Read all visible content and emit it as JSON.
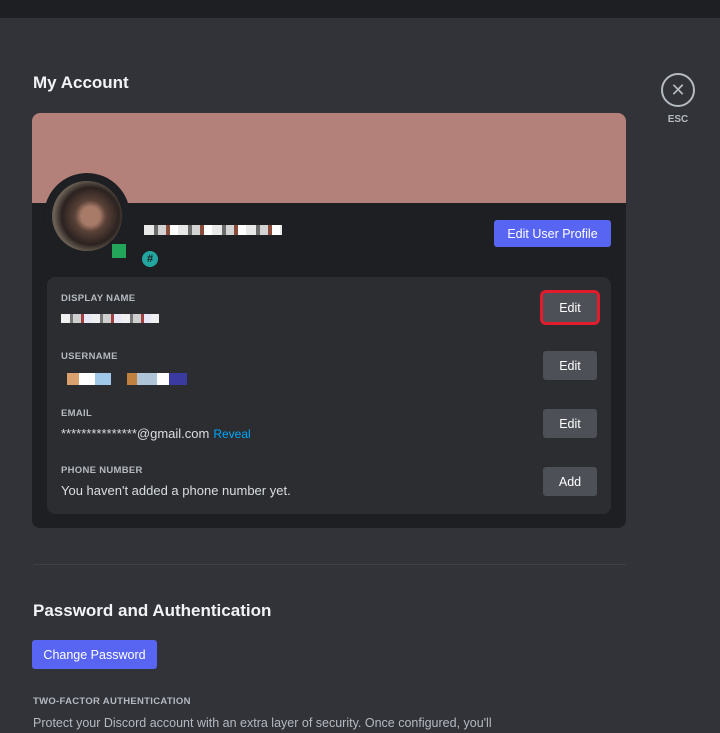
{
  "header": {
    "title": "My Account",
    "close_label": "ESC",
    "close_icon": "close-icon"
  },
  "profile": {
    "tag_symbol": "#",
    "edit_profile_label": "Edit User Profile",
    "banner_color": "#b3817a",
    "status_color": "#23a55a"
  },
  "fields": {
    "display_name": {
      "label": "DISPLAY NAME",
      "action": "Edit"
    },
    "username": {
      "label": "USERNAME",
      "action": "Edit"
    },
    "email": {
      "label": "EMAIL",
      "value": "***************@gmail.com",
      "reveal": "Reveal",
      "action": "Edit"
    },
    "phone": {
      "label": "PHONE NUMBER",
      "value": "You haven't added a phone number yet.",
      "action": "Add"
    }
  },
  "security": {
    "title": "Password and Authentication",
    "change_password_label": "Change Password",
    "twofa_label": "TWO-FACTOR AUTHENTICATION",
    "twofa_description": "Protect your Discord account with an extra layer of security. Once configured, you'll"
  },
  "colors": {
    "accent": "#5865f2",
    "highlight": "#e21c2c",
    "link": "#00a8fc"
  }
}
